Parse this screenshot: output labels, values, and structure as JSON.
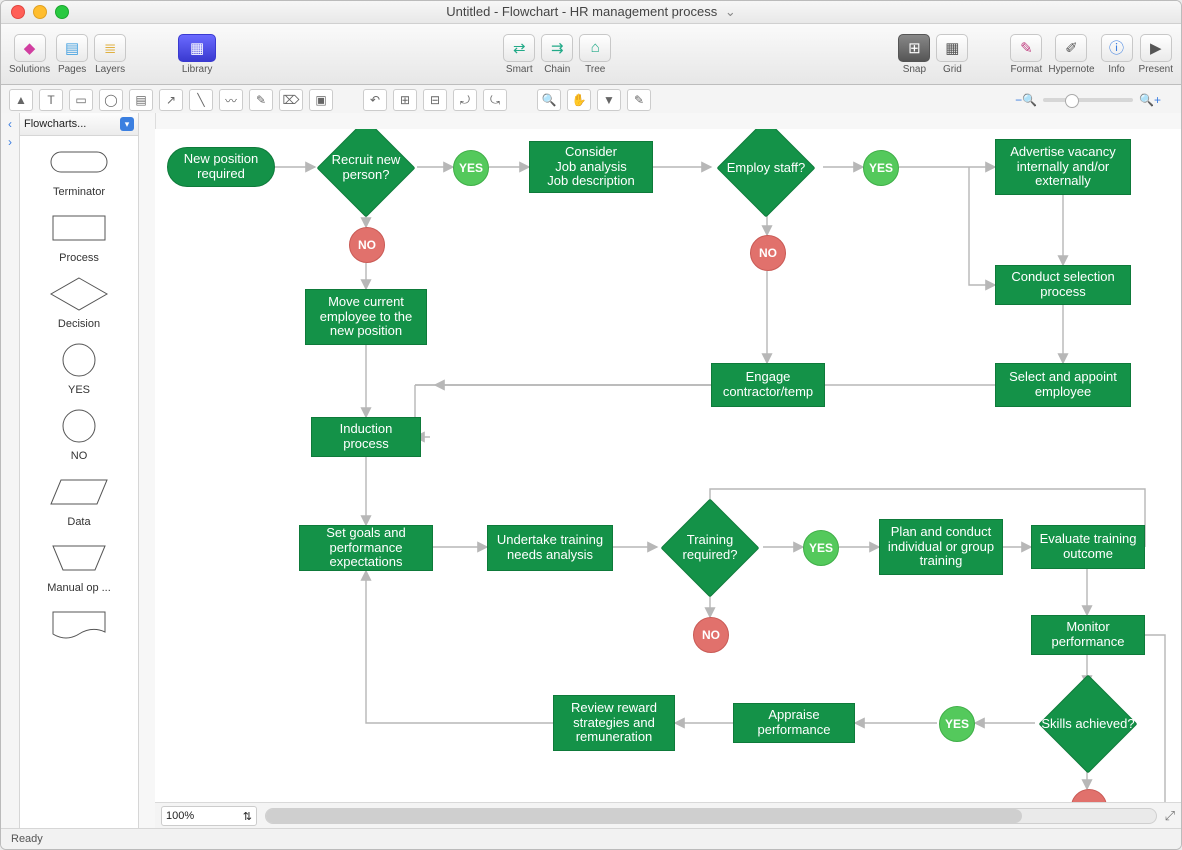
{
  "title": "Untitled - Flowchart - HR management process",
  "toolbar": {
    "solutions": "Solutions",
    "pages": "Pages",
    "layers": "Layers",
    "library": "Library",
    "smart": "Smart",
    "chain": "Chain",
    "tree": "Tree",
    "snap": "Snap",
    "grid": "Grid",
    "format": "Format",
    "hypernote": "Hypernote",
    "info": "Info",
    "present": "Present"
  },
  "library_selector": "Flowcharts...",
  "palette": {
    "terminator": "Terminator",
    "process": "Process",
    "decision": "Decision",
    "yes": "YES",
    "no": "NO",
    "data": "Data",
    "manual": "Manual op ...",
    "doc": ""
  },
  "zoom_value": "100%",
  "status": "Ready",
  "yn": {
    "yes": "YES",
    "no": "NO"
  },
  "nodes": {
    "new_pos": "New position required",
    "recruit": "Recruit new person?",
    "consider": "Consider\nJob analysis\nJob description",
    "employ": "Employ staff?",
    "advertise": "Advertise vacancy internally and/or externally",
    "conduct_sel": "Conduct selection process",
    "select_appoint": "Select and appoint employee",
    "move_emp": "Move current employee to the new position",
    "engage": "Engage contractor/temp",
    "induction": "Induction process",
    "set_goals": "Set goals and performance expectations",
    "train_analysis": "Undertake training needs analysis",
    "train_req": "Training required?",
    "plan_train": "Plan and conduct individual or group training",
    "eval_train": "Evaluate training outcome",
    "monitor": "Monitor performance",
    "skills": "Skills achieved?",
    "appraise": "Appraise performance",
    "review_reward": "Review reward strategies and remuneration"
  }
}
